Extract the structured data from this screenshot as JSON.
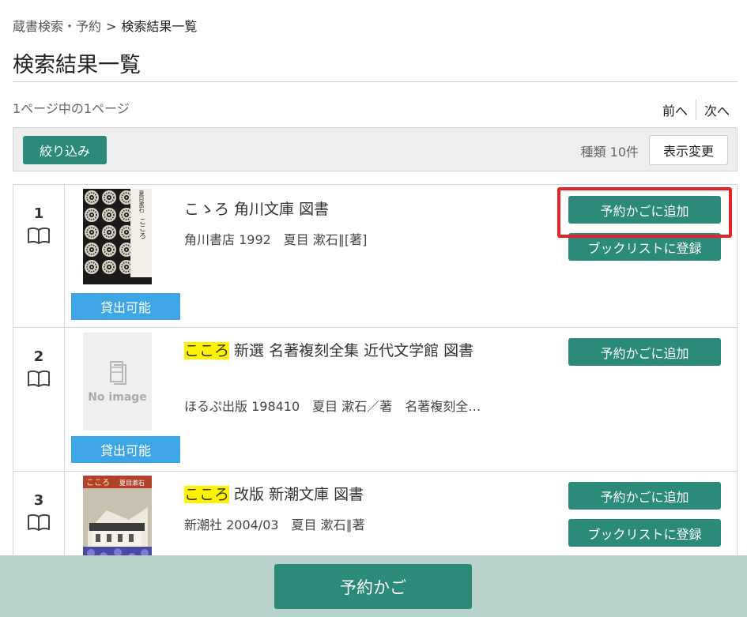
{
  "breadcrumb": {
    "parent": "蔵書検索・予約",
    "separator": ">",
    "current": "検索結果一覧"
  },
  "page_title": "検索結果一覧",
  "page_info": "1ページ中の1ページ",
  "pager": {
    "prev": "前へ",
    "next": "次へ"
  },
  "toolbar": {
    "filter_label": "絞り込み",
    "count_text": "種類 10件",
    "display_label": "表示変更"
  },
  "results": [
    {
      "number": "1",
      "title_highlight": "",
      "title_rest": "こゝろ 角川文庫 図書",
      "meta": "角川書店 1992　夏目 漱石∥[著]",
      "availability": "貸出可能",
      "cover": "cover-kadokawa",
      "cover_text": {
        "title": "こころ",
        "author": "夏目漱石"
      },
      "buttons": [
        "予約かごに追加",
        "ブックリストに登録"
      ]
    },
    {
      "number": "2",
      "title_highlight": "こころ",
      "title_rest": " 新選 名著複刻全集 近代文学館 図書",
      "meta": "ほるぷ出版 198410　夏目 漱石／著　名著複刻全…",
      "availability": "貸出可能",
      "cover": "no-image",
      "no_image_text": "No image",
      "buttons": [
        "予約かごに追加"
      ]
    },
    {
      "number": "3",
      "title_highlight": "こころ",
      "title_rest": " 改版 新潮文庫 図書",
      "meta": "新潮社 2004/03　夏目 漱石∥著",
      "availability": "",
      "cover": "cover-shincho",
      "cover_text": {
        "title": "こころ",
        "author": "夏目漱石"
      },
      "buttons": [
        "予約かごに追加",
        "ブックリストに登録"
      ]
    }
  ],
  "footer": {
    "cart_label": "予約かご"
  },
  "colors": {
    "primary": "#2b8a7a",
    "available": "#3ea6e5",
    "highlight": "#fff200",
    "annotation": "#e8202a",
    "footer_bg": "#b7d3cc"
  },
  "icons": {
    "book": "book-open-icon",
    "no_image": "book-placeholder-icon"
  }
}
